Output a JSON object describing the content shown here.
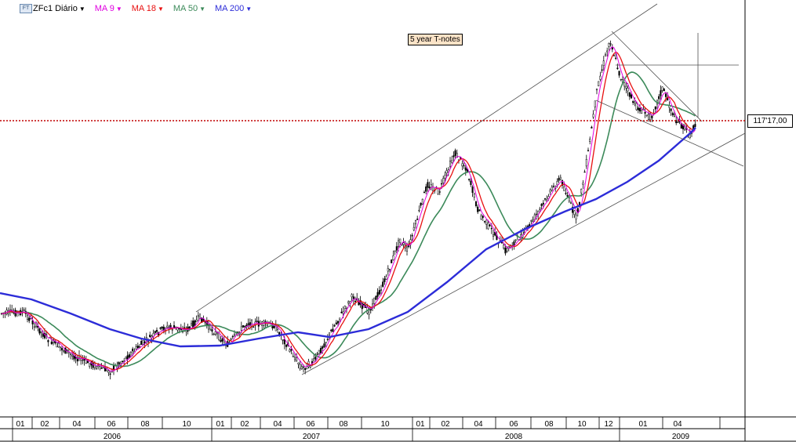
{
  "toolbar": {
    "symbol_badge": "FT",
    "symbol": "ZFc1 Diário",
    "legend": [
      {
        "label": "MA 9",
        "color": "#e000e0"
      },
      {
        "label": "MA 18",
        "color": "#e81010"
      },
      {
        "label": "MA 50",
        "color": "#3c8a5a"
      },
      {
        "label": "MA 200",
        "color": "#2c2cd8"
      }
    ]
  },
  "annotation": {
    "text": "5 year T-notes"
  },
  "price_label": {
    "text": "117'17,00"
  },
  "colors": {
    "candle_up": "#000000",
    "candle_down": "#000000",
    "support_line": "#c00000",
    "trendline": "#505050"
  },
  "chart_data": {
    "type": "line",
    "title": "5 year T-notes",
    "xlabel": "",
    "ylabel": "",
    "x_start": "2005-12",
    "x_end": "2009-06",
    "y_axis_labels": [
      "117'17,00"
    ],
    "current_level": "117'17,00",
    "months": [
      {
        "label": "01",
        "year": "2006"
      },
      {
        "label": "02",
        "year": "2006"
      },
      {
        "label": "04",
        "year": "2006"
      },
      {
        "label": "06",
        "year": "2006"
      },
      {
        "label": "08",
        "year": "2006"
      },
      {
        "label": "10",
        "year": "2006"
      },
      {
        "label": "01",
        "year": "2007"
      },
      {
        "label": "02",
        "year": "2007"
      },
      {
        "label": "04",
        "year": "2007"
      },
      {
        "label": "06",
        "year": "2007"
      },
      {
        "label": "08",
        "year": "2007"
      },
      {
        "label": "10",
        "year": "2007"
      },
      {
        "label": "01",
        "year": "2008"
      },
      {
        "label": "02",
        "year": "2008"
      },
      {
        "label": "04",
        "year": "2008"
      },
      {
        "label": "06",
        "year": "2008"
      },
      {
        "label": "08",
        "year": "2008"
      },
      {
        "label": "10",
        "year": "2008"
      },
      {
        "label": "12",
        "year": "2008"
      },
      {
        "label": "01",
        "year": "2009"
      },
      {
        "label": "04",
        "year": "2009"
      }
    ],
    "years": [
      "2006",
      "2007",
      "2008",
      "2009"
    ],
    "series": [
      {
        "name": "MA 200",
        "values": [
          104.4,
          103.6,
          102.8,
          102.3,
          102.4,
          102.6,
          103.4,
          104.5,
          106.2,
          108.6,
          110.8,
          112.6,
          114.4,
          115.8,
          116.4
        ]
      },
      {
        "name": "MA 50",
        "values": [
          103.8,
          101.6,
          101.0,
          102.8,
          103.4,
          102.8,
          102.0,
          104.0,
          107.6,
          109.2,
          108.4,
          109.8,
          119.4,
          118.2,
          116.6
        ]
      }
    ]
  }
}
